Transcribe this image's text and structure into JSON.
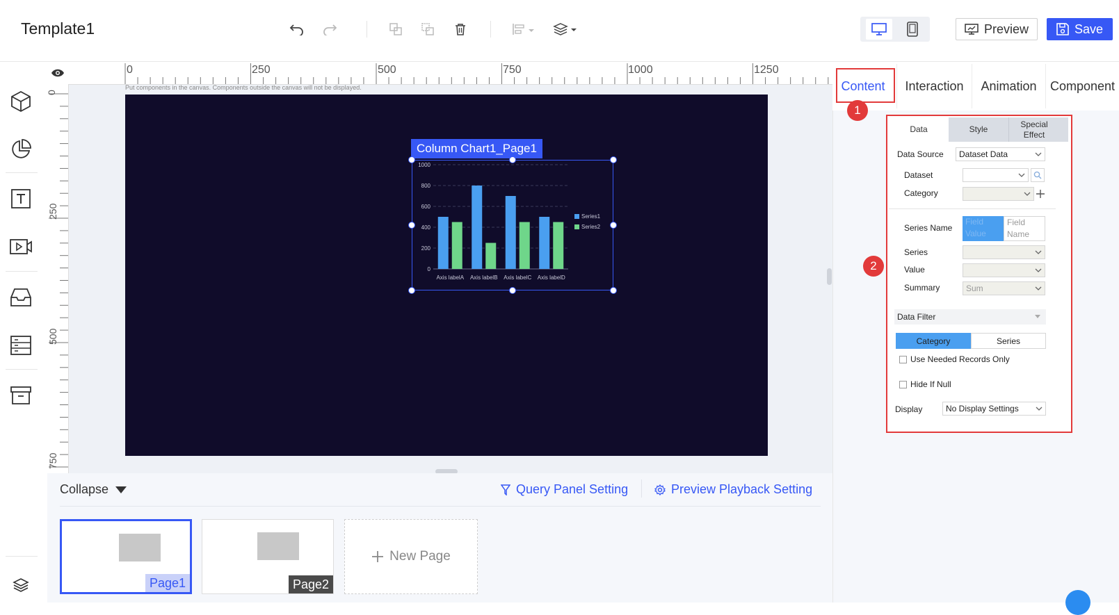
{
  "app": {
    "title": "Template1"
  },
  "toolbar": {
    "icons": [
      "undo-icon",
      "redo-icon",
      "combine-icon",
      "split-icon",
      "delete-icon",
      "align-icon",
      "layers-icon"
    ],
    "preview_label": "Preview",
    "save_label": "Save",
    "devices": [
      "desktop-icon",
      "tablet-icon"
    ]
  },
  "ruler": {
    "h_ticks": [
      "0",
      "250",
      "500",
      "750",
      "1000",
      "1250"
    ],
    "v_ticks": [
      "0",
      "250",
      "500",
      "750"
    ]
  },
  "canvas": {
    "hint": "Put components in the canvas. Components outside the canvas will not be displayed.",
    "component_label": "Column Chart1_Page1"
  },
  "chart_data": {
    "type": "bar",
    "categories": [
      "Axis labelA",
      "Axis labelB",
      "Axis labelC",
      "Axis labelD"
    ],
    "series": [
      {
        "name": "Series1",
        "values": [
          500,
          800,
          700,
          500
        ],
        "color": "#4a9ff0"
      },
      {
        "name": "Series2",
        "values": [
          450,
          250,
          450,
          450
        ],
        "color": "#6fd68a"
      }
    ],
    "ylim": [
      0,
      1000
    ],
    "yticks": [
      "0",
      "200",
      "400",
      "600",
      "800",
      "1000"
    ],
    "grid": true,
    "legend": "right"
  },
  "bottom": {
    "collapse_label": "Collapse",
    "query_label": "Query Panel Setting",
    "playback_label": "Preview Playback Setting",
    "pages": [
      "Page1",
      "Page2"
    ],
    "new_page_label": "New Page"
  },
  "right_tabs": [
    "Content",
    "Interaction",
    "Animation",
    "Component"
  ],
  "badges": [
    "1",
    "2"
  ],
  "props": {
    "tabs": [
      "Data",
      "Style",
      "Special Effect"
    ],
    "data_source_label": "Data Source",
    "data_source_value": "Dataset Data",
    "dataset_label": "Dataset",
    "category_label": "Category",
    "series_name_label": "Series Name",
    "series_name_options": [
      "Field Value",
      "Field Name"
    ],
    "series_label": "Series",
    "value_label": "Value",
    "summary_label": "Summary",
    "summary_value": "Sum",
    "data_filter_label": "Data Filter",
    "filter_tabs": [
      "Category",
      "Series"
    ],
    "use_needed_label": "Use Needed Records Only",
    "hide_null_label": "Hide If Null",
    "display_label": "Display",
    "display_value": "No Display Settings"
  },
  "colors": {
    "accent": "#3758f5",
    "highlight": "#e23a3a",
    "stage": "#100c2a"
  }
}
